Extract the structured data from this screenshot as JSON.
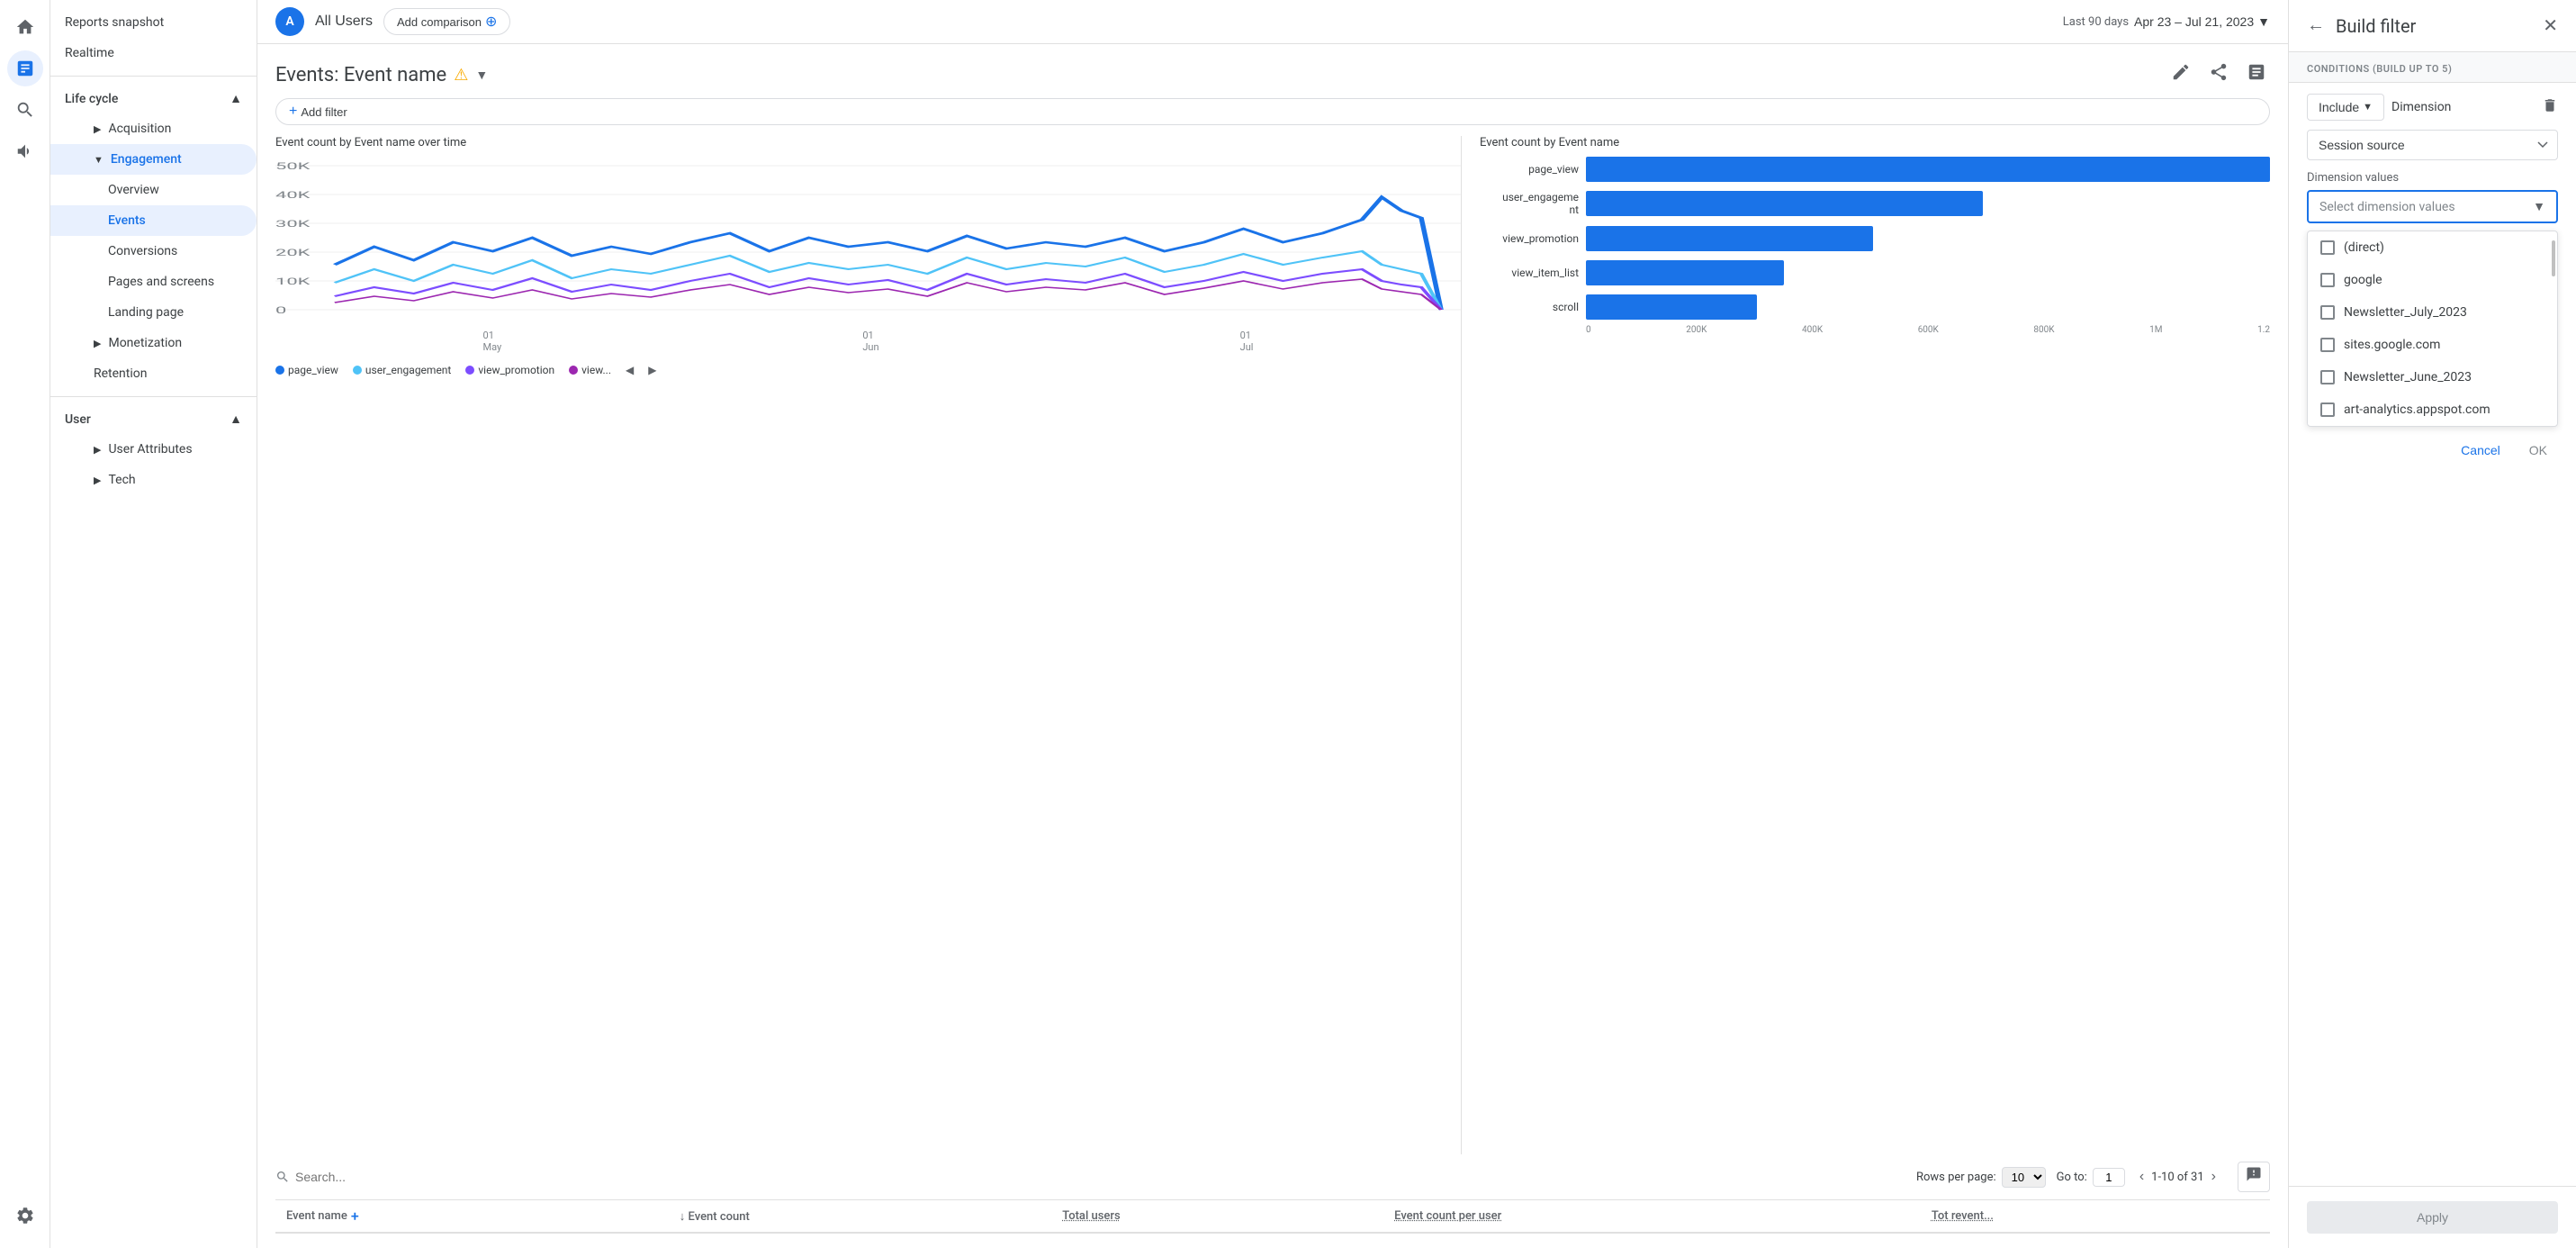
{
  "sidebar_icons": {
    "home_icon": "⌂",
    "analytics_icon": "📊",
    "explore_icon": "🔍",
    "advertising_icon": "📢"
  },
  "sidebar": {
    "top_items": [
      {
        "label": "Reports snapshot",
        "id": "reports-snapshot"
      },
      {
        "label": "Realtime",
        "id": "realtime"
      }
    ],
    "lifecycle_label": "Life cycle",
    "lifecycle_items": [
      {
        "label": "Acquisition",
        "id": "acquisition",
        "type": "parent"
      },
      {
        "label": "Engagement",
        "id": "engagement",
        "type": "parent",
        "expanded": true
      },
      {
        "label": "Overview",
        "id": "overview",
        "type": "child"
      },
      {
        "label": "Events",
        "id": "events",
        "type": "child",
        "active": true
      },
      {
        "label": "Conversions",
        "id": "conversions",
        "type": "child"
      },
      {
        "label": "Pages and screens",
        "id": "pages-screens",
        "type": "child"
      },
      {
        "label": "Landing page",
        "id": "landing-page",
        "type": "child"
      },
      {
        "label": "Monetization",
        "id": "monetization",
        "type": "parent"
      },
      {
        "label": "Retention",
        "id": "retention",
        "type": "top"
      }
    ],
    "user_label": "User",
    "user_items": [
      {
        "label": "User Attributes",
        "id": "user-attributes",
        "type": "parent"
      },
      {
        "label": "Tech",
        "id": "tech",
        "type": "parent"
      }
    ],
    "settings_icon": "⚙"
  },
  "topbar": {
    "user_initial": "A",
    "all_users_label": "All Users",
    "add_comparison_label": "Add comparison",
    "last_period_label": "Last 90 days",
    "date_range_label": "Apr 23 – Jul 21, 2023"
  },
  "page": {
    "title": "Events: Event name",
    "add_filter_label": "Add filter",
    "actions": {
      "edit_icon": "✏",
      "share_icon": "⬆",
      "insights_icon": "✦"
    }
  },
  "chart_left": {
    "title": "Event count by Event name over time",
    "y_labels": [
      "50K",
      "40K",
      "30K",
      "20K",
      "10K",
      "0"
    ],
    "x_labels": [
      "01 May",
      "01 Jun",
      "01 Jul"
    ],
    "legend": [
      {
        "label": "page_view",
        "color": "#1a73e8"
      },
      {
        "label": "user_engagement",
        "color": "#4fc3f7"
      },
      {
        "label": "view_promotion",
        "color": "#7c4dff"
      },
      {
        "label": "view...",
        "color": "#9c27b0"
      }
    ]
  },
  "chart_right": {
    "title": "Event count by Event name",
    "bars": [
      {
        "label": "page_view",
        "value": 1200000,
        "pct": 100
      },
      {
        "label": "user_engageme nt",
        "value": 700000,
        "pct": 58
      },
      {
        "label": "view_promotion",
        "value": 500000,
        "pct": 42
      },
      {
        "label": "view_item_list",
        "value": 350000,
        "pct": 29
      },
      {
        "label": "scroll",
        "value": 300000,
        "pct": 25
      }
    ],
    "x_labels": [
      "0",
      "200K",
      "400K",
      "600K",
      "800K",
      "1M",
      "1.2"
    ]
  },
  "table": {
    "search_placeholder": "Search...",
    "rows_per_page_label": "Rows per page:",
    "rows_per_page_value": "10",
    "goto_label": "Go to:",
    "goto_value": "1",
    "pagination_label": "1-10 of 31",
    "columns": [
      {
        "label": "Event name",
        "sortable": false
      },
      {
        "label": "↓ Event count",
        "sortable": true
      },
      {
        "label": "Total users",
        "sortable": false,
        "dotted": true
      },
      {
        "label": "Event count per user",
        "sortable": false,
        "dotted": true
      },
      {
        "label": "Tot revent...",
        "sortable": false,
        "dotted": true
      }
    ]
  },
  "filter_panel": {
    "title": "Build filter",
    "conditions_label": "CONDITIONS (BUILD UP TO 5)",
    "include_label": "Include",
    "dimension_label": "Dimension",
    "dimension_select_label": "Session source",
    "dimension_values_label": "Dimension values",
    "select_placeholder": "Select dimension values",
    "dropdown_items": [
      {
        "label": "(direct)",
        "checked": false
      },
      {
        "label": "google",
        "checked": false
      },
      {
        "label": "Newsletter_July_2023",
        "checked": false
      },
      {
        "label": "sites.google.com",
        "checked": false
      },
      {
        "label": "Newsletter_June_2023",
        "checked": false
      },
      {
        "label": "art-analytics.appspot.com",
        "checked": false
      }
    ],
    "cancel_label": "Cancel",
    "ok_label": "OK",
    "apply_label": "Apply"
  }
}
